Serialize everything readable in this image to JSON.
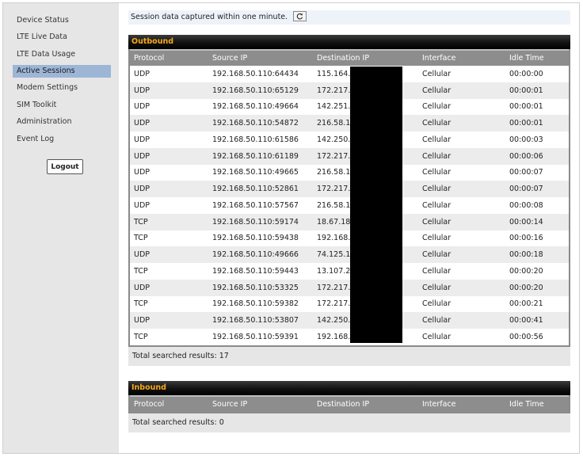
{
  "sidebar": {
    "items": [
      {
        "label": "Device Status",
        "active": false
      },
      {
        "label": "LTE Live Data",
        "active": false
      },
      {
        "label": "LTE Data Usage",
        "active": false
      },
      {
        "label": "Active Sessions",
        "active": true
      },
      {
        "label": "Modem Settings",
        "active": false
      },
      {
        "label": "SIM Toolkit",
        "active": false
      },
      {
        "label": "Administration",
        "active": false
      },
      {
        "label": "Event Log",
        "active": false
      }
    ],
    "logout_label": "Logout"
  },
  "info": {
    "text": "Session data captured within one minute.",
    "refresh_icon": "refresh-icon"
  },
  "columns": [
    "Protocol",
    "Source IP",
    "Destination IP",
    "Interface",
    "Idle Time"
  ],
  "outbound": {
    "title": "Outbound",
    "rows": [
      [
        "UDP",
        "192.168.50.110:64434",
        "115.164.",
        "Cellular",
        "00:00:00"
      ],
      [
        "UDP",
        "192.168.50.110:65129",
        "172.217.",
        "Cellular",
        "00:00:01"
      ],
      [
        "UDP",
        "192.168.50.110:49664",
        "142.251.",
        "Cellular",
        "00:00:01"
      ],
      [
        "UDP",
        "192.168.50.110:54872",
        "216.58.1",
        "Cellular",
        "00:00:01"
      ],
      [
        "UDP",
        "192.168.50.110:61586",
        "142.250.",
        "Cellular",
        "00:00:03"
      ],
      [
        "UDP",
        "192.168.50.110:61189",
        "172.217.",
        "Cellular",
        "00:00:06"
      ],
      [
        "UDP",
        "192.168.50.110:49665",
        "216.58.1",
        "Cellular",
        "00:00:07"
      ],
      [
        "UDP",
        "192.168.50.110:52861",
        "172.217.",
        "Cellular",
        "00:00:07"
      ],
      [
        "UDP",
        "192.168.50.110:57567",
        "216.58.1",
        "Cellular",
        "00:00:08"
      ],
      [
        "TCP",
        "192.168.50.110:59174",
        "18.67.18",
        "Cellular",
        "00:00:14"
      ],
      [
        "TCP",
        "192.168.50.110:59438",
        "192.168.",
        "Cellular",
        "00:00:16"
      ],
      [
        "UDP",
        "192.168.50.110:49666",
        "74.125.1",
        "Cellular",
        "00:00:18"
      ],
      [
        "TCP",
        "192.168.50.110:59443",
        "13.107.2",
        "Cellular",
        "00:00:20"
      ],
      [
        "UDP",
        "192.168.50.110:53325",
        "172.217.",
        "Cellular",
        "00:00:20"
      ],
      [
        "TCP",
        "192.168.50.110:59382",
        "172.217.",
        "Cellular",
        "00:00:21"
      ],
      [
        "UDP",
        "192.168.50.110:53807",
        "142.250.",
        "Cellular",
        "00:00:41"
      ],
      [
        "TCP",
        "192.168.50.110:59391",
        "192.168.",
        "Cellular",
        "00:00:56"
      ]
    ],
    "total": "Total searched results: 17"
  },
  "inbound": {
    "title": "Inbound",
    "rows": [],
    "total": "Total searched results: 0"
  },
  "colors": {
    "accent_header_text": "#f7a81b",
    "active_nav": "#9db6d6",
    "table_header": "#8d8d8d"
  }
}
